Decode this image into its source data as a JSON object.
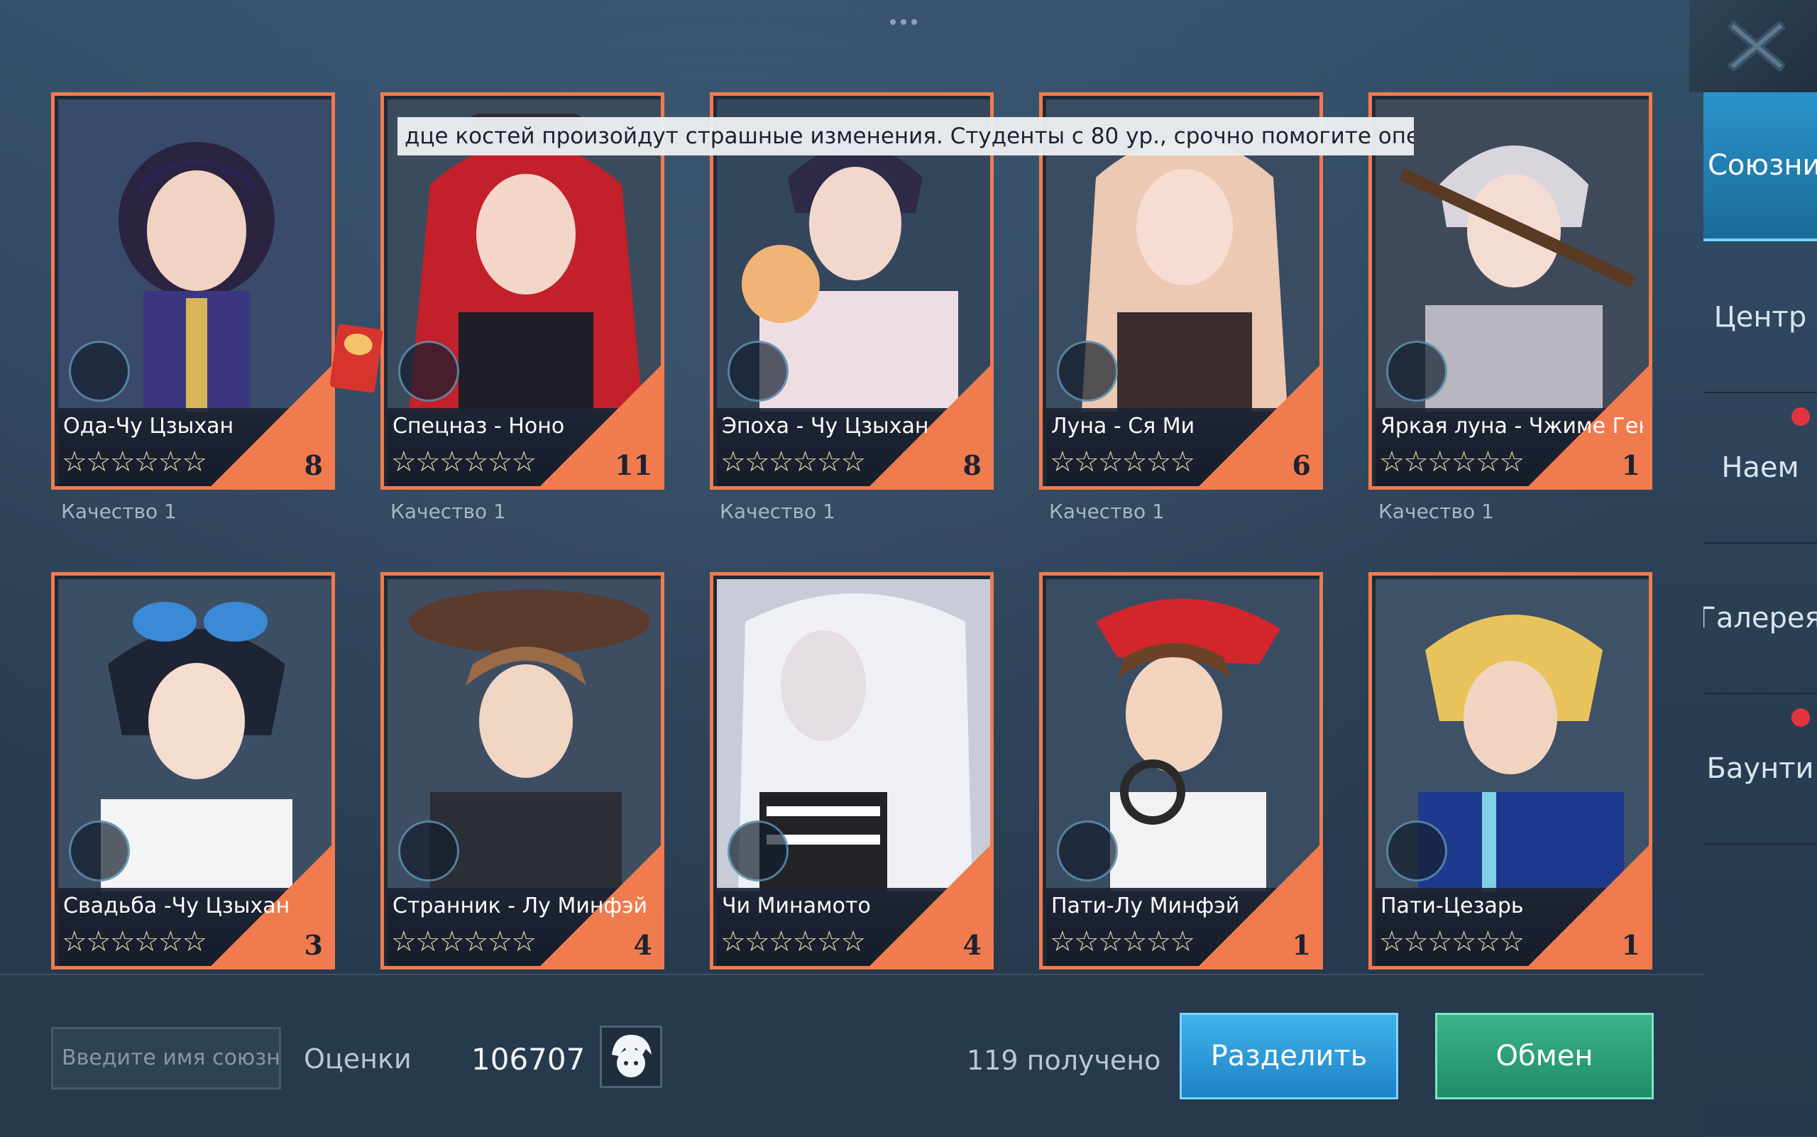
{
  "header": {
    "close_icon": "close-x-icon"
  },
  "tooltip": {
    "text": "дце костей произойдут страшные изменения. Студенты с 80 ур., срочно помогите опер"
  },
  "sidebar": {
    "items": [
      {
        "label": "Союзник",
        "active": true,
        "badge": false
      },
      {
        "label": "Центр",
        "active": false,
        "badge": false
      },
      {
        "label": "Наем",
        "active": false,
        "badge": true
      },
      {
        "label": "Галерея",
        "active": false,
        "badge": false
      },
      {
        "label": "Баунти",
        "active": false,
        "badge": true
      }
    ]
  },
  "cards": [
    {
      "name": "Ода-Чу Цзыхан",
      "stars": "☆☆☆☆☆☆",
      "count": "8",
      "quality": "Качество 1"
    },
    {
      "name": "Спецназ - Ноно",
      "stars": "☆☆☆☆☆☆",
      "count": "11",
      "quality": "Качество 1"
    },
    {
      "name": "Эпоха - Чу Цзыхан",
      "stars": "☆☆☆☆☆☆",
      "count": "8",
      "quality": "Качество 1"
    },
    {
      "name": "Луна - Ся Ми",
      "stars": "☆☆☆☆☆☆",
      "count": "6",
      "quality": "Качество 1"
    },
    {
      "name": "Яркая луна - Чжиме Ген",
      "stars": "☆☆☆☆☆☆",
      "count": "1",
      "quality": "Качество 1"
    },
    {
      "name": "Свадьба -Чу Цзыхан",
      "stars": "☆☆☆☆☆☆",
      "count": "3",
      "quality": ""
    },
    {
      "name": "Странник - Лу Минфэй",
      "stars": "☆☆☆☆☆☆",
      "count": "4",
      "quality": ""
    },
    {
      "name": "Чи Минамото",
      "stars": "☆☆☆☆☆☆",
      "count": "4",
      "quality": ""
    },
    {
      "name": "Пати-Лу Минфэй",
      "stars": "☆☆☆☆☆☆",
      "count": "1",
      "quality": ""
    },
    {
      "name": "Пати-Цезарь",
      "stars": "☆☆☆☆☆☆",
      "count": "1",
      "quality": ""
    }
  ],
  "bottom": {
    "search_placeholder": "Введите имя союзн",
    "rating_label": "Оценки",
    "rating_value": "106707",
    "received_text": "119 получено",
    "split_label": "Разделить",
    "exchange_label": "Обмен"
  },
  "colors": {
    "accent_orange": "#f07b4e",
    "split_blue": "#2a95d6",
    "exchange_green": "#2ea37a",
    "background": "#2b3f55"
  }
}
